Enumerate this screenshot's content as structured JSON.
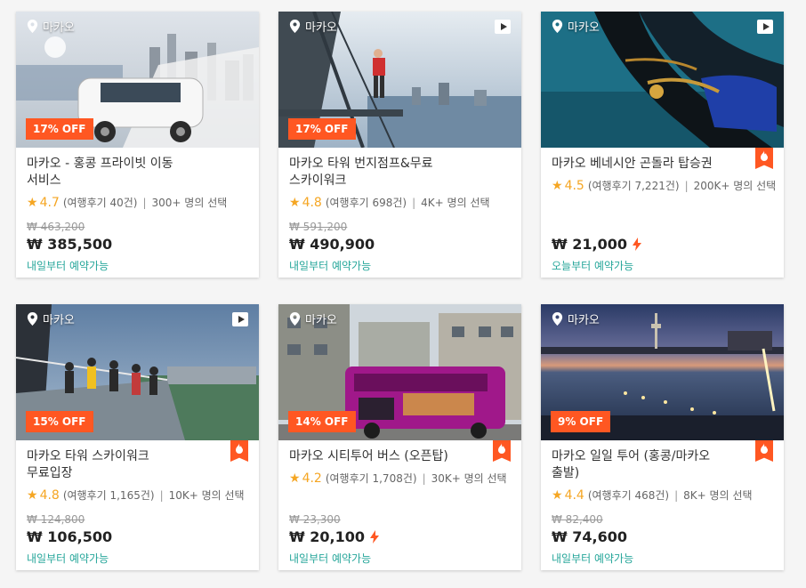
{
  "cards": [
    {
      "location": "마카오",
      "has_video": false,
      "discount": "17% OFF",
      "title_line1": "마카오 - 홍콩 프라이빗 이동",
      "title_line2": "서비스",
      "rating": "4.7",
      "reviews": "(여행후기 40건)",
      "chosen": "300+ 명의 선택",
      "old_price": "₩ 463,200",
      "price": "₩ 385,500",
      "flash": false,
      "hot": false,
      "availability": "내일부터 예약가능",
      "image": "van"
    },
    {
      "location": "마카오",
      "has_video": true,
      "discount": "17% OFF",
      "title_line1": "마카오 타워 번지점프&무료",
      "title_line2": "스카이워크",
      "rating": "4.8",
      "reviews": "(여행후기 698건)",
      "chosen": "4K+ 명의 선택",
      "old_price": "₩ 591,200",
      "price": "₩ 490,900",
      "flash": false,
      "hot": false,
      "availability": "내일부터 예약가능",
      "image": "bungee"
    },
    {
      "location": "마카오",
      "has_video": true,
      "discount": "",
      "title_line1": "마카오 베네시안 곤돌라 탑승권",
      "title_line2": "",
      "rating": "4.5",
      "reviews": "(여행후기 7,221건)",
      "chosen": "200K+ 명의 선택",
      "old_price": "",
      "price": "₩ 21,000",
      "flash": true,
      "hot": true,
      "availability": "오늘부터 예약가능",
      "image": "gondola"
    },
    {
      "location": "마카오",
      "has_video": true,
      "discount": "15% OFF",
      "title_line1": "마카오 타워 스카이워크",
      "title_line2": "무료입장",
      "rating": "4.8",
      "reviews": "(여행후기 1,165건)",
      "chosen": "10K+ 명의 선택",
      "old_price": "₩ 124,800",
      "price": "₩ 106,500",
      "flash": false,
      "hot": true,
      "availability": "내일부터 예약가능",
      "image": "skywalk"
    },
    {
      "location": "마카오",
      "has_video": false,
      "discount": "14% OFF",
      "title_line1": "마카오 시티투어 버스 (오픈탑)",
      "title_line2": "",
      "rating": "4.2",
      "reviews": "(여행후기 1,708건)",
      "chosen": "30K+ 명의 선택",
      "old_price": "₩ 23,300",
      "price": "₩ 20,100",
      "flash": true,
      "hot": true,
      "availability": "내일부터 예약가능",
      "image": "bus"
    },
    {
      "location": "마카오",
      "has_video": false,
      "discount": "9% OFF",
      "title_line1": "마카오 일일 투어 (홍콩/마카오",
      "title_line2": "출발)",
      "rating": "4.4",
      "reviews": "(여행후기 468건)",
      "chosen": "8K+ 명의 선택",
      "old_price": "₩ 82,400",
      "price": "₩ 74,600",
      "flash": false,
      "hot": true,
      "availability": "내일부터 예약가능",
      "image": "night"
    }
  ],
  "colors": {
    "accent": "#ff5722",
    "star": "#f5a623",
    "available": "#26a69a"
  },
  "icons": {
    "location": "map-pin-icon",
    "video": "play-icon",
    "hot": "fire-icon",
    "flash": "lightning-icon",
    "star": "star-icon"
  }
}
